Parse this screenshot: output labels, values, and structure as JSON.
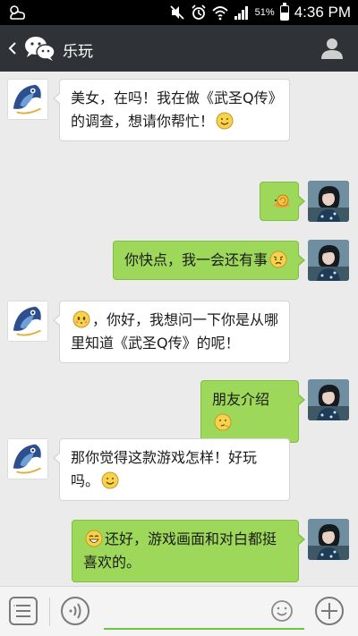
{
  "status_bar": {
    "battery": "51%",
    "battery_level": 0.51,
    "time": "4:36 PM",
    "icons": [
      "weather-icon",
      "mute-icon",
      "alarm-icon",
      "wifi-icon",
      "signal-icon",
      "battery-icon"
    ]
  },
  "header": {
    "title": "乐玩",
    "icons": [
      "back-icon",
      "wechat-logo-icon",
      "contact-icon"
    ]
  },
  "messages": [
    {
      "side": "left",
      "parts": [
        {
          "text": "美女，在吗！我在做《武圣Q传》的调查，想请你帮忙！"
        },
        {
          "emoji": "smile"
        }
      ]
    },
    {
      "side": "right",
      "parts": [
        {
          "emoji": "snail"
        }
      ]
    },
    {
      "side": "right",
      "parts": [
        {
          "text": "你快点，我一会还有事"
        },
        {
          "emoji": "angry"
        }
      ]
    },
    {
      "side": "left",
      "parts": [
        {
          "emoji": "shy"
        },
        {
          "text": "，你好，我想问一下你是从哪里知道《武圣Q传》的呢！"
        }
      ]
    },
    {
      "side": "right",
      "parts": [
        {
          "text": "朋友介绍"
        },
        {
          "emoji": "think"
        }
      ]
    },
    {
      "side": "left",
      "parts": [
        {
          "text": "那你觉得这款游戏怎样！好玩吗。"
        },
        {
          "emoji": "smile"
        }
      ]
    },
    {
      "side": "right",
      "parts": [
        {
          "emoji": "grin"
        },
        {
          "text": "还好，游戏画面和对白都挺喜欢的。"
        }
      ]
    }
  ],
  "input_bar": {
    "icons": [
      "menu-icon",
      "voice-icon",
      "emoji-icon",
      "plus-icon"
    ],
    "input_value": ""
  },
  "colors": {
    "sent_bubble": "#9ed85a",
    "received_bubble": "#ffffff",
    "header_bg": "#2f3236",
    "chat_bg": "#ebebeb",
    "input_accent": "#6cc644"
  }
}
